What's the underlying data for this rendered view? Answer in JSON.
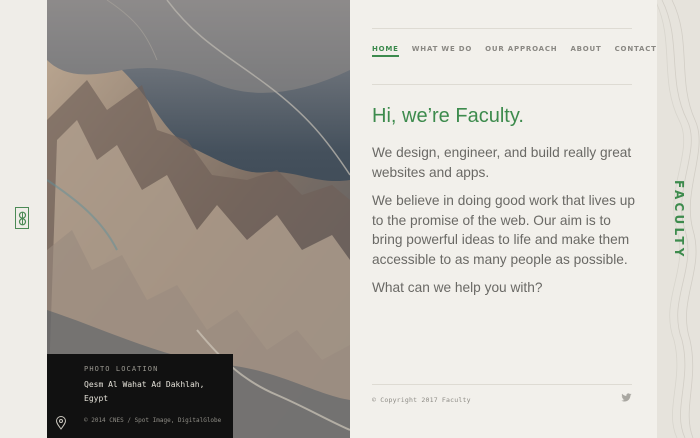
{
  "brand": "FACULTY",
  "nav": {
    "items": [
      {
        "label": "HOME",
        "active": true
      },
      {
        "label": "WHAT WE DO",
        "active": false
      },
      {
        "label": "OUR APPROACH",
        "active": false
      },
      {
        "label": "ABOUT",
        "active": false
      },
      {
        "label": "CONTACT",
        "active": false
      }
    ]
  },
  "hero": {
    "headline": "Hi, we’re Faculty.",
    "paragraphs": [
      "We design, engineer, and build really great websites and apps.",
      "We believe in doing good work that lives up to the promise of the web. Our aim is to bring powerful ideas to life and make them accessible to as many people as possible.",
      "What can we help you with?"
    ]
  },
  "photo": {
    "label": "PHOTO LOCATION",
    "place": "Qesm Al Wahat Ad Dakhlah, Egypt",
    "credit": "© 2014 CNES / Spot Image, DigitalGlobe"
  },
  "footer": {
    "copyright": "© Copyright 2017 Faculty",
    "social_icon": "twitter-icon"
  },
  "colors": {
    "accent": "#3d8b4d",
    "background": "#f2f0eb",
    "text": "#6a6965"
  }
}
